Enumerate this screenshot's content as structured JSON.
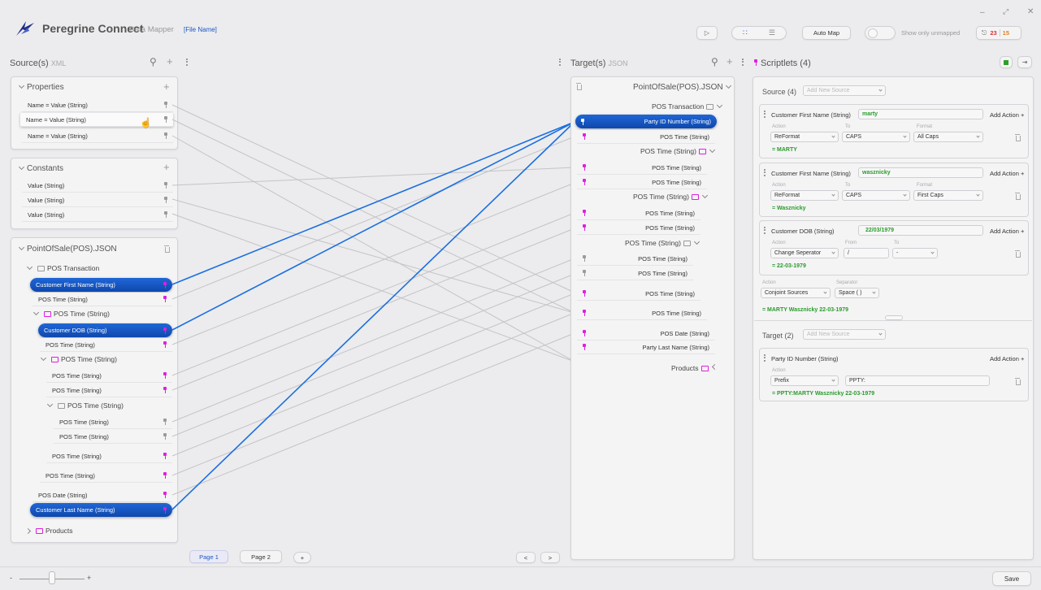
{
  "app": {
    "brand": "Peregrine Connect",
    "module": "Data Mapper",
    "file_name": "[File Name]",
    "brand_color": "#1f2e8a",
    "accent_color": "#1459c9"
  },
  "toolbar": {
    "auto_map_label": "Auto Map",
    "show_unmapped_label": "Show only unmapped",
    "notif_red": "23",
    "notif_green": "15"
  },
  "source_panel": {
    "title": "Source(s)",
    "type": "XML",
    "properties": {
      "title": "Properties",
      "rows": [
        "Name = Value (String)",
        "Name = Value (String)",
        "Name = Value (String)"
      ]
    },
    "constants": {
      "title": "Constants",
      "rows": [
        "Value (String)",
        "Value (String)",
        "Value (String)"
      ]
    },
    "pos": {
      "title": "PointOfSale(POS).JSON",
      "transaction": "POS Transaction",
      "rows": [
        "Customer First Name (String)",
        "POS Time (String)",
        "POS Time (String)",
        "Customer DOB (String)",
        "POS Time (String)",
        "POS Time (String)",
        "POS Time (String)",
        "POS Time (String)",
        "POS Time (String)",
        "POS Time (String)",
        "POS Time (String)",
        "POS Time (String)",
        "POS Time (String)",
        "POS Date (String)",
        "Customer Last Name (String)",
        "Products"
      ]
    }
  },
  "pages": {
    "page1": "Page 1",
    "page2": "Page 2",
    "add": "+",
    "prev": "<",
    "next": ">"
  },
  "target_panel": {
    "title": "Target(s)",
    "type": "JSON",
    "root": "PointOfSale(POS).JSON",
    "transaction": "POS Transaction",
    "rows": [
      "Party ID Number (String)",
      "POS Time (String)",
      "POS Time (String)",
      "POS Time (String)",
      "POS Time (String)",
      "POS Time (String)",
      "POS Time (String)",
      "POS Time (String)",
      "POS Time (String)",
      "POS Time (String)",
      "POS Time (String)",
      "POS Time (String)",
      "POS Time (String)",
      "POS Date (String)",
      "Party Last Name (String)",
      "Products"
    ]
  },
  "scriptlets": {
    "title": "Scriptlets (4)",
    "source_label": "Source (4)",
    "add_new_source": "Add New Source",
    "add_action": "Add Action +",
    "action_lbl": "Action",
    "to_lbl": "To",
    "format_lbl": "Format",
    "from_lbl": "From",
    "separator_lbl": "Separator",
    "cards": [
      {
        "field": "Customer First Name (String)",
        "value": "marty",
        "action": "ReFormat",
        "to": "CAPS",
        "format": "All Caps",
        "result": "= MARTY"
      },
      {
        "field": "Customer First Name (String)",
        "value": "wasznicky",
        "action": "ReFormat",
        "to": "CAPS",
        "format": "First Caps",
        "result": "= Wasznicky"
      },
      {
        "field": "Customer DOB (String)",
        "value": "22/03/1979",
        "action": "Change Seperator",
        "from": "/",
        "to": "-",
        "result": "= 22-03-1979"
      }
    ],
    "conjoint": {
      "action": "Conjoint Sources",
      "separator": "Space ( )",
      "result": "= MARTY Wasznicky 22-03-1979"
    },
    "target_label": "Target (2)",
    "target_card": {
      "field": "Party ID Number (String)",
      "action": "Prefix",
      "value": "PPTY:",
      "result": "= PPTY:MARTY Wasznicky 22-03-1979"
    }
  },
  "footer": {
    "zoom_minus": "-",
    "zoom_plus": "+",
    "save_label": "Save"
  }
}
